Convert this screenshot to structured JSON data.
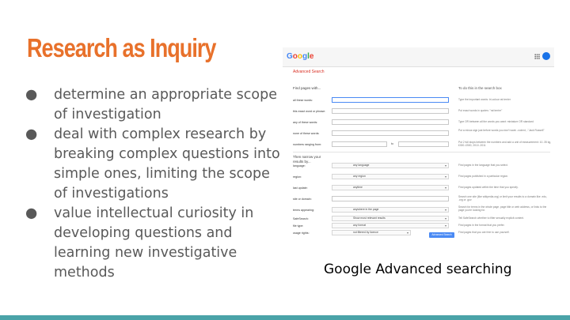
{
  "slide": {
    "title": "Research as Inquiry",
    "bullets": [
      "determine an appropriate scope of investigation",
      "deal with complex research by breaking complex questions into simple ones, limiting the scope of investigations",
      "value intellectual curiosity in developing questions and learning new investigative methods"
    ],
    "bullet_marker": "●",
    "caption": "Google Advanced searching"
  },
  "screenshot": {
    "logo_letters": [
      {
        "ch": "G",
        "color": "#4285f4"
      },
      {
        "ch": "o",
        "color": "#ea4335"
      },
      {
        "ch": "o",
        "color": "#fbbc05"
      },
      {
        "ch": "g",
        "color": "#4285f4"
      },
      {
        "ch": "l",
        "color": "#34a853"
      },
      {
        "ch": "e",
        "color": "#ea4335"
      }
    ],
    "avatar_letter": "k",
    "page_heading": "Advanced Search",
    "find_pages_label": "Find pages with...",
    "to_do_label": "To do this in the search box",
    "narrow_label": "Then narrow your results by...",
    "keyword_rows": [
      {
        "label": "all these words:",
        "tip": "Type the important words: tri-colour rat terrier"
      },
      {
        "label": "this exact word or phrase:",
        "tip": "Put exact words in quotes: \"rat terrier\""
      },
      {
        "label": "any of these words:",
        "tip": "Type OR between all the words you want: miniature OR standard"
      },
      {
        "label": "none of these words:",
        "tip": "Put a minus sign just before words you don't want: -rodent, -\"Jack Russell\""
      },
      {
        "label": "numbers ranging from:",
        "tip": "Put 2 full stops between the numbers and add a unit of measurement: 10..35 kg, £300..£500, 2010..2011",
        "to": "to"
      }
    ],
    "narrow_rows": [
      {
        "label": "language:",
        "value": "any language",
        "tip": "Find pages in the language that you select."
      },
      {
        "label": "region:",
        "value": "any region",
        "tip": "Find pages published in a particular region."
      },
      {
        "label": "last update:",
        "value": "anytime",
        "tip": "Find pages updated within the time that you specify."
      },
      {
        "label": "site or domain:",
        "value": "",
        "tip": "Search one site (like wikipedia.org) or limit your results to a domain like .edu, .org or .gov"
      },
      {
        "label": "terms appearing:",
        "value": "anywhere in the page",
        "tip": "Search for terms in the whole page, page title or web address, or links to the page you're looking for."
      },
      {
        "label": "SafeSearch:",
        "value": "Show most relevant results",
        "tip": "Tell SafeSearch whether to filter sexually explicit content."
      },
      {
        "label": "file type:",
        "value": "any format",
        "tip": "Find pages in the format that you prefer."
      },
      {
        "label": "usage rights:",
        "value": "not filtered by licence",
        "tip": "Find pages that you are free to use yourself."
      }
    ],
    "search_button": "Advanced Search"
  }
}
